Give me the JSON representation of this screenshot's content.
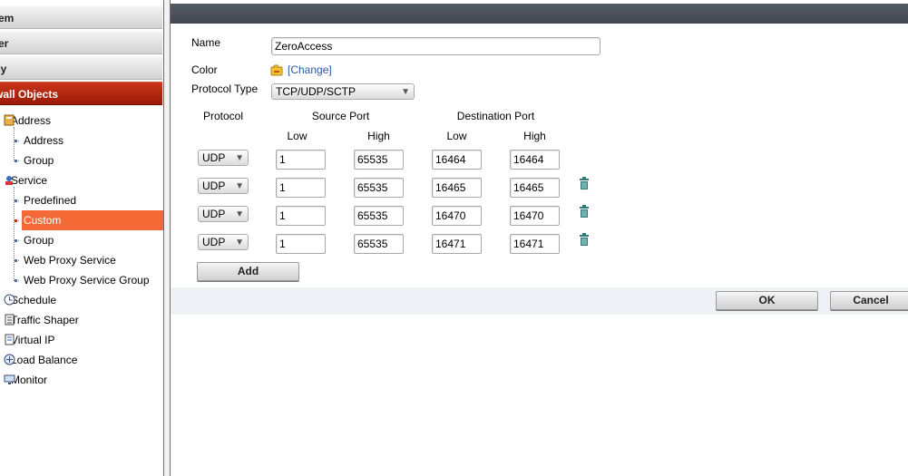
{
  "sidebar": {
    "sections": [
      {
        "label": "tem",
        "active": false
      },
      {
        "label": "ter",
        "active": false
      },
      {
        "label": "cy",
        "active": false
      },
      {
        "label": "wall Objects",
        "active": true
      }
    ],
    "tree": [
      {
        "label": "Address",
        "icon": "address-book-icon"
      },
      {
        "label": "Address"
      },
      {
        "label": "Group"
      },
      {
        "label": "Service",
        "icon": "service-icon"
      },
      {
        "label": "Predefined"
      },
      {
        "label": "Custom",
        "selected": true
      },
      {
        "label": "Group"
      },
      {
        "label": "Web Proxy Service"
      },
      {
        "label": "Web Proxy Service Group"
      },
      {
        "label": "Schedule",
        "icon": "clock-icon"
      },
      {
        "label": "Traffic Shaper",
        "icon": "shaper-icon"
      },
      {
        "label": "Virtual IP",
        "icon": "virtual-ip-icon"
      },
      {
        "label": "Load Balance",
        "icon": "load-balance-icon"
      },
      {
        "label": "Monitor",
        "icon": "monitor-icon"
      }
    ]
  },
  "form": {
    "name_label": "Name",
    "name_value": "ZeroAccess",
    "color_label": "Color",
    "color_change": "[Change]",
    "protocol_type_label": "Protocol Type",
    "protocol_type_value": "TCP/UDP/SCTP",
    "headers": {
      "protocol": "Protocol",
      "source_port": "Source Port",
      "destination_port": "Destination Port",
      "low": "Low",
      "high": "High"
    },
    "rows": [
      {
        "protocol": "UDP",
        "src_low": "1",
        "src_high": "65535",
        "dst_low": "16464",
        "dst_high": "16464",
        "deletable": false
      },
      {
        "protocol": "UDP",
        "src_low": "1",
        "src_high": "65535",
        "dst_low": "16465",
        "dst_high": "16465",
        "deletable": true
      },
      {
        "protocol": "UDP",
        "src_low": "1",
        "src_high": "65535",
        "dst_low": "16470",
        "dst_high": "16470",
        "deletable": true
      },
      {
        "protocol": "UDP",
        "src_low": "1",
        "src_high": "65535",
        "dst_low": "16471",
        "dst_high": "16471",
        "deletable": true
      }
    ],
    "add_button": "Add",
    "ok_button": "OK",
    "cancel_button": "Cancel"
  },
  "colors": {
    "active_section": "#b02810",
    "selected_item": "#f46a36",
    "topbar": "#4b5058",
    "link": "#2b5aa8",
    "trash": "#2f7a7a"
  }
}
